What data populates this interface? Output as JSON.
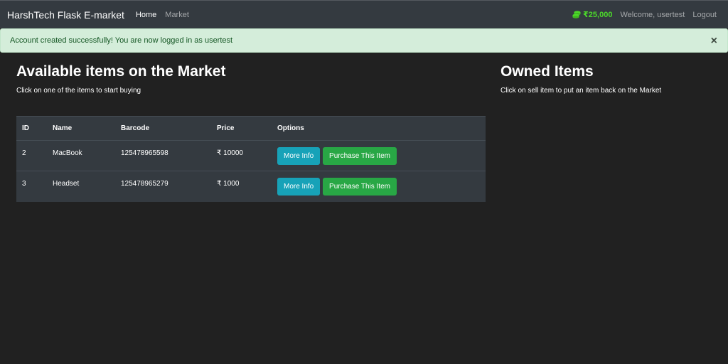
{
  "navbar": {
    "brand": "HarshTech Flask E-market",
    "links": {
      "home": "Home",
      "market": "Market"
    },
    "budget": "₹25,000",
    "budget_icon": "coins-icon",
    "welcome": "Welcome, usertest",
    "logout": "Logout"
  },
  "alert": {
    "message": "Account created successfully! You are now logged in as usertest",
    "close": "×"
  },
  "market": {
    "title": "Available items on the Market",
    "subtitle": "Click on one of the items to start buying",
    "columns": [
      "ID",
      "Name",
      "Barcode",
      "Price",
      "Options"
    ],
    "rows": [
      {
        "id": "2",
        "name": "MacBook",
        "barcode": "125478965598",
        "price": "₹ 10000",
        "more_info": "More Info",
        "purchase": "Purchase This Item"
      },
      {
        "id": "3",
        "name": "Headset",
        "barcode": "125478965279",
        "price": "₹ 1000",
        "more_info": "More Info",
        "purchase": "Purchase This Item"
      }
    ]
  },
  "owned": {
    "title": "Owned Items",
    "subtitle": "Click on sell item to put an item back on the Market"
  },
  "colors": {
    "background": "#212121",
    "navbar": "#343a40",
    "budget": "#4cd92a",
    "alert_bg": "#d4edda",
    "btn_info": "#17a2b8",
    "btn_success": "#28a745"
  }
}
